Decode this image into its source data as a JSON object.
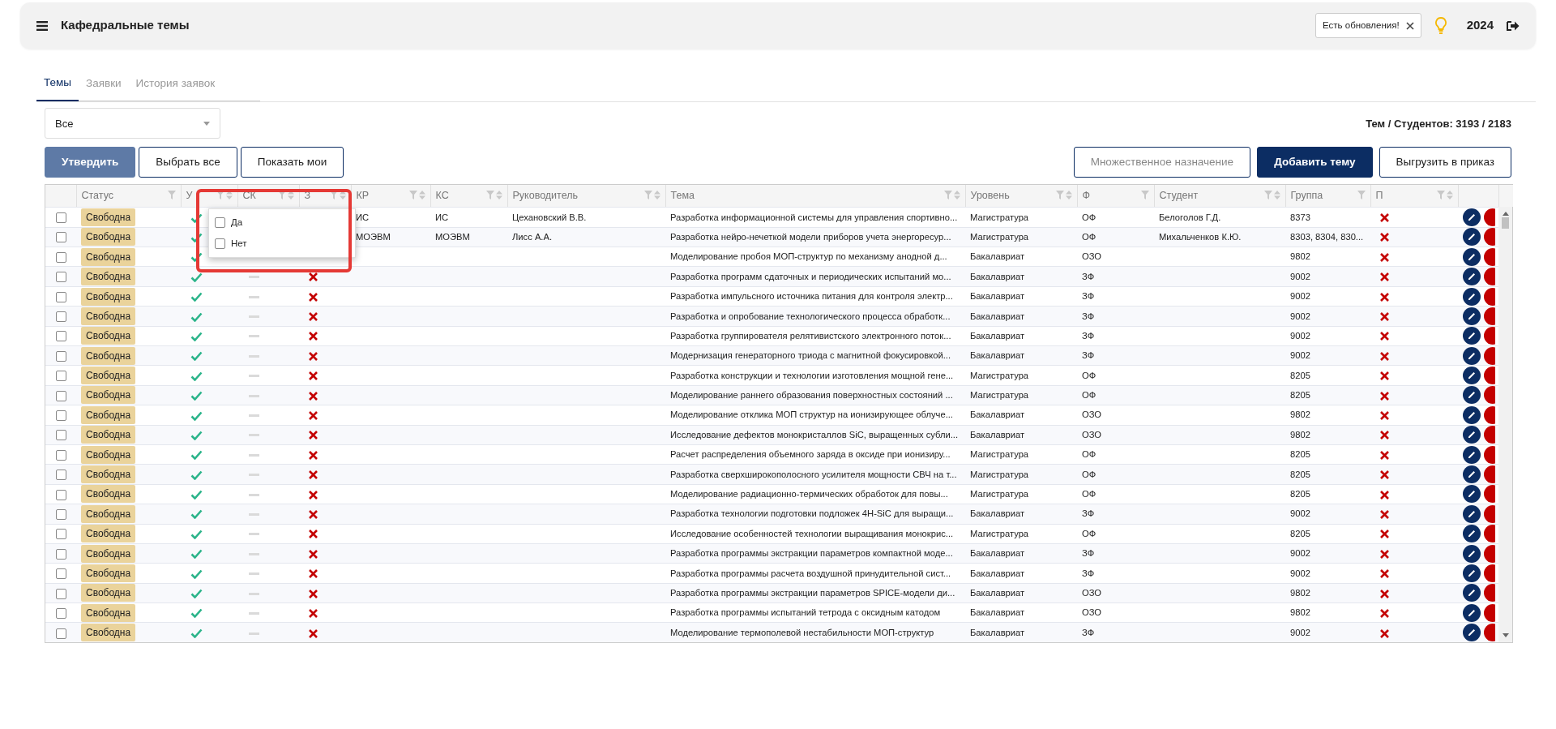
{
  "header": {
    "title": "Кафедральные темы",
    "notification": "Есть обновления!",
    "year": "2024"
  },
  "tabs": [
    {
      "label": "Темы",
      "selected": true
    },
    {
      "label": "Заявки",
      "selected": false
    },
    {
      "label": "История заявок",
      "selected": false
    }
  ],
  "filter_select": {
    "value": "Все"
  },
  "summary": "Тем / Студентов: 3193 / 2183",
  "left_buttons": [
    {
      "label": "Утвердить",
      "kind": "primary"
    },
    {
      "label": "Выбрать все",
      "kind": "outline"
    },
    {
      "label": "Показать мои",
      "kind": "outline"
    }
  ],
  "right_buttons": [
    {
      "label": "Множественное назначение",
      "kind": "muted"
    },
    {
      "label": "Добавить тему",
      "kind": "primary"
    },
    {
      "label": "Выгрузить в приказ",
      "kind": "outline"
    }
  ],
  "table": {
    "columns": [
      {
        "label": "Статус",
        "filter": true,
        "sort": false
      },
      {
        "label": "У",
        "filter": true,
        "sort": true
      },
      {
        "label": "СК",
        "filter": true,
        "sort": true
      },
      {
        "label": "З",
        "filter": true,
        "sort": true
      },
      {
        "label": "КР",
        "filter": true,
        "sort": true
      },
      {
        "label": "КС",
        "filter": true,
        "sort": true
      },
      {
        "label": "Руководитель",
        "filter": true,
        "sort": true
      },
      {
        "label": "Тема",
        "filter": true,
        "sort": true
      },
      {
        "label": "Уровень",
        "filter": true,
        "sort": true
      },
      {
        "label": "Ф",
        "filter": true,
        "sort": false
      },
      {
        "label": "Студент",
        "filter": true,
        "sort": true
      },
      {
        "label": "Группа",
        "filter": true,
        "sort": false
      },
      {
        "label": "П",
        "filter": true,
        "sort": true
      }
    ],
    "rows": [
      {
        "checked": false,
        "status": "Свободна",
        "u": true,
        "kr": "ИС",
        "ks": "ИС",
        "supervisor": "Цехановский В.В.",
        "topic": "Разработка информационной системы для управления спортивно...",
        "level": "Магистратура",
        "form": "ОФ",
        "student": "Белоголов Г.Д.",
        "group": "8373",
        "p": false
      },
      {
        "checked": false,
        "status": "Свободна",
        "u": true,
        "kr": "МОЭВМ",
        "ks": "МОЭВМ",
        "supervisor": "Лисс А.А.",
        "topic": "Разработка нейро-нечеткой модели приборов учета энергоресур...",
        "level": "Магистратура",
        "form": "ОФ",
        "student": "Михальченков К.Ю.",
        "group": "8303, 8304, 830...",
        "p": false
      },
      {
        "checked": false,
        "status": "Свободна",
        "u": true,
        "topic": "Моделирование пробоя МОП-структур по механизму анодной д...",
        "level": "Бакалавриат",
        "form": "ОЗО",
        "group": "9802",
        "p": false
      },
      {
        "checked": false,
        "status": "Свободна",
        "u": true,
        "sk_empty": true,
        "z": false,
        "topic": "Разработка программ сдаточных и периодических испытаний мо...",
        "level": "Бакалавриат",
        "form": "ЗФ",
        "group": "9002",
        "p": false
      },
      {
        "checked": false,
        "status": "Свободна",
        "u": true,
        "sk_empty": true,
        "z": false,
        "topic": "Разработка импульсного источника питания для контроля электр...",
        "level": "Бакалавриат",
        "form": "ЗФ",
        "group": "9002",
        "p": false
      },
      {
        "checked": false,
        "status": "Свободна",
        "u": true,
        "sk_empty": true,
        "z": false,
        "topic": "Разработка и опробование технологического процесса обработк...",
        "level": "Бакалавриат",
        "form": "ЗФ",
        "group": "9002",
        "p": false
      },
      {
        "checked": false,
        "status": "Свободна",
        "u": true,
        "sk_empty": true,
        "z": false,
        "topic": "Разработка группирователя релятивистского электронного поток...",
        "level": "Бакалавриат",
        "form": "ЗФ",
        "group": "9002",
        "p": false
      },
      {
        "checked": false,
        "status": "Свободна",
        "u": true,
        "sk_empty": true,
        "z": false,
        "topic": "Модернизация генераторного триода с магнитной фокусировкой...",
        "level": "Бакалавриат",
        "form": "ЗФ",
        "group": "9002",
        "p": false
      },
      {
        "checked": false,
        "status": "Свободна",
        "u": true,
        "sk_empty": true,
        "z": false,
        "topic": "Разработка конструкции и технологии изготовления мощной гене...",
        "level": "Магистратура",
        "form": "ОФ",
        "group": "8205",
        "p": false
      },
      {
        "checked": false,
        "status": "Свободна",
        "u": true,
        "sk_empty": true,
        "z": false,
        "topic": "Моделирование раннего образования поверхностных состояний ...",
        "level": "Магистратура",
        "form": "ОФ",
        "group": "8205",
        "p": false
      },
      {
        "checked": false,
        "status": "Свободна",
        "u": true,
        "sk_empty": true,
        "z": false,
        "topic": "Моделирование отклика МОП структур на ионизирующее облуче...",
        "level": "Бакалавриат",
        "form": "ОЗО",
        "group": "9802",
        "p": false
      },
      {
        "checked": false,
        "status": "Свободна",
        "u": true,
        "sk_empty": true,
        "z": false,
        "topic": "Исследование дефектов монокристаллов SiC, выращенных субли...",
        "level": "Бакалавриат",
        "form": "ОЗО",
        "group": "9802",
        "p": false
      },
      {
        "checked": false,
        "status": "Свободна",
        "u": true,
        "sk_empty": true,
        "z": false,
        "topic": "Расчет распределения объемного заряда в оксиде при ионизиру...",
        "level": "Магистратура",
        "form": "ОФ",
        "group": "8205",
        "p": false
      },
      {
        "checked": false,
        "status": "Свободна",
        "u": true,
        "sk_empty": true,
        "z": false,
        "topic": "Разработка сверхширокополосного усилителя мощности СВЧ на т...",
        "level": "Магистратура",
        "form": "ОФ",
        "group": "8205",
        "p": false
      },
      {
        "checked": false,
        "status": "Свободна",
        "u": true,
        "sk_empty": true,
        "z": false,
        "topic": "Моделирование радиационно-термических обработок для повы...",
        "level": "Магистратура",
        "form": "ОФ",
        "group": "8205",
        "p": false
      },
      {
        "checked": false,
        "status": "Свободна",
        "u": true,
        "sk_empty": true,
        "z": false,
        "topic": "Разработка технологии подготовки подложек 4H-SiC для выращи...",
        "level": "Бакалавриат",
        "form": "ЗФ",
        "group": "9002",
        "p": false
      },
      {
        "checked": false,
        "status": "Свободна",
        "u": true,
        "sk_empty": true,
        "z": false,
        "topic": "Исследование особенностей технологии выращивания монокрис...",
        "level": "Магистратура",
        "form": "ОФ",
        "group": "8205",
        "p": false
      },
      {
        "checked": false,
        "status": "Свободна",
        "u": true,
        "sk_empty": true,
        "z": false,
        "topic": "Разработка программы экстракции параметров компактной моде...",
        "level": "Бакалавриат",
        "form": "ЗФ",
        "group": "9002",
        "p": false
      },
      {
        "checked": false,
        "status": "Свободна",
        "u": true,
        "sk_empty": true,
        "z": false,
        "topic": "Разработка программы расчета воздушной принудительной сист...",
        "level": "Бакалавриат",
        "form": "ЗФ",
        "group": "9002",
        "p": false
      },
      {
        "checked": false,
        "status": "Свободна",
        "u": true,
        "sk_empty": true,
        "z": false,
        "topic": "Разработка программы экстракции параметров SPICE-модели ди...",
        "level": "Бакалавриат",
        "form": "ОЗО",
        "group": "9802",
        "p": false
      },
      {
        "checked": false,
        "status": "Свободна",
        "u": true,
        "sk_empty": true,
        "z": false,
        "topic": "Разработка программы испытаний тетрода с оксидным катодом",
        "level": "Бакалавриат",
        "form": "ОЗО",
        "group": "9802",
        "p": false
      },
      {
        "checked": false,
        "status": "Свободна",
        "u": true,
        "sk_empty": true,
        "z": false,
        "topic": "Моделирование термополевой нестабильности МОП-структур",
        "level": "Бакалавриат",
        "form": "ЗФ",
        "group": "9002",
        "p": false
      }
    ]
  },
  "filter_popup": {
    "options": [
      {
        "label": "Да",
        "checked": false
      },
      {
        "label": "Нет",
        "checked": false
      }
    ]
  }
}
